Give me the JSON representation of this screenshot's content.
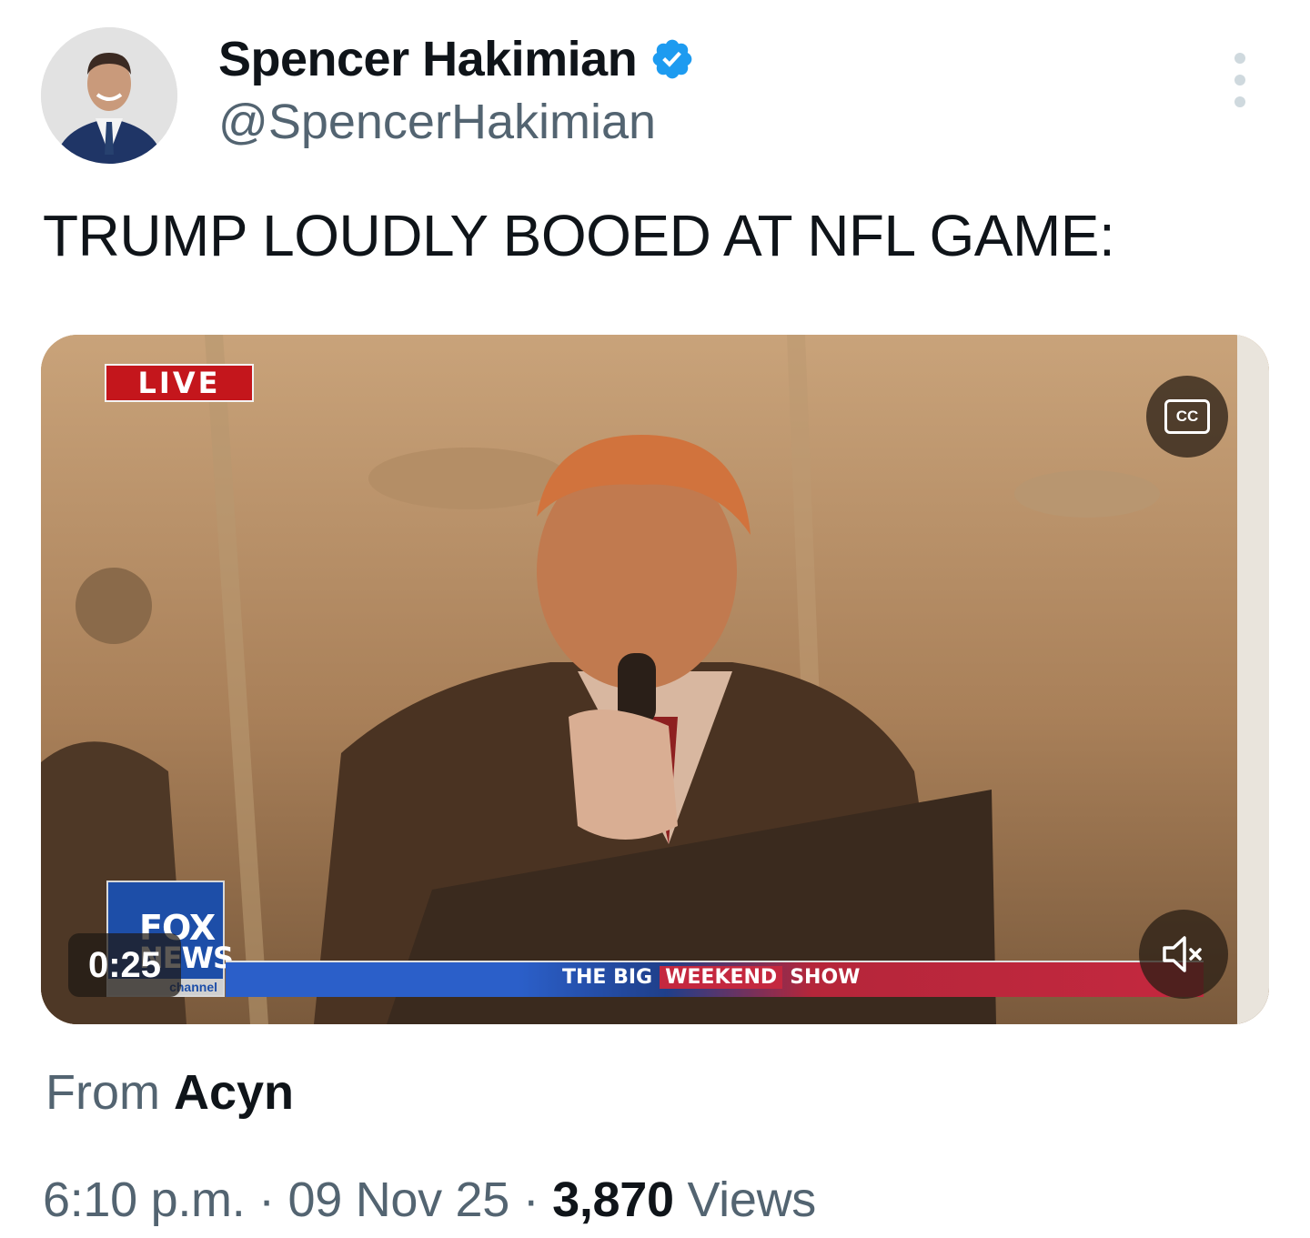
{
  "author": {
    "name": "Spencer Hakimian",
    "handle": "@SpencerHakimian",
    "verified": true,
    "verified_color": "#1d9bf0"
  },
  "tweet": {
    "text": "TRUMP LOUDLY BOOED AT NFL GAME:"
  },
  "media": {
    "live_label": "LIVE",
    "cc_label": "CC",
    "duration": "0:25",
    "broadcaster_logo": {
      "line1": "FOX",
      "line2": "NEWS",
      "line3": "channel"
    },
    "ticker": {
      "pre": "THE BIG",
      "mid": "WEEKEND",
      "post": "SHOW"
    }
  },
  "attribution": {
    "prefix": "From",
    "source": "Acyn"
  },
  "meta": {
    "time": "6:10 p.m.",
    "date": "09 Nov 25",
    "views_count": "3,870",
    "views_label": "Views",
    "separator": "·"
  },
  "colors": {
    "text_primary": "#0f1419",
    "text_secondary": "#536471",
    "live_red": "#c4161c"
  }
}
